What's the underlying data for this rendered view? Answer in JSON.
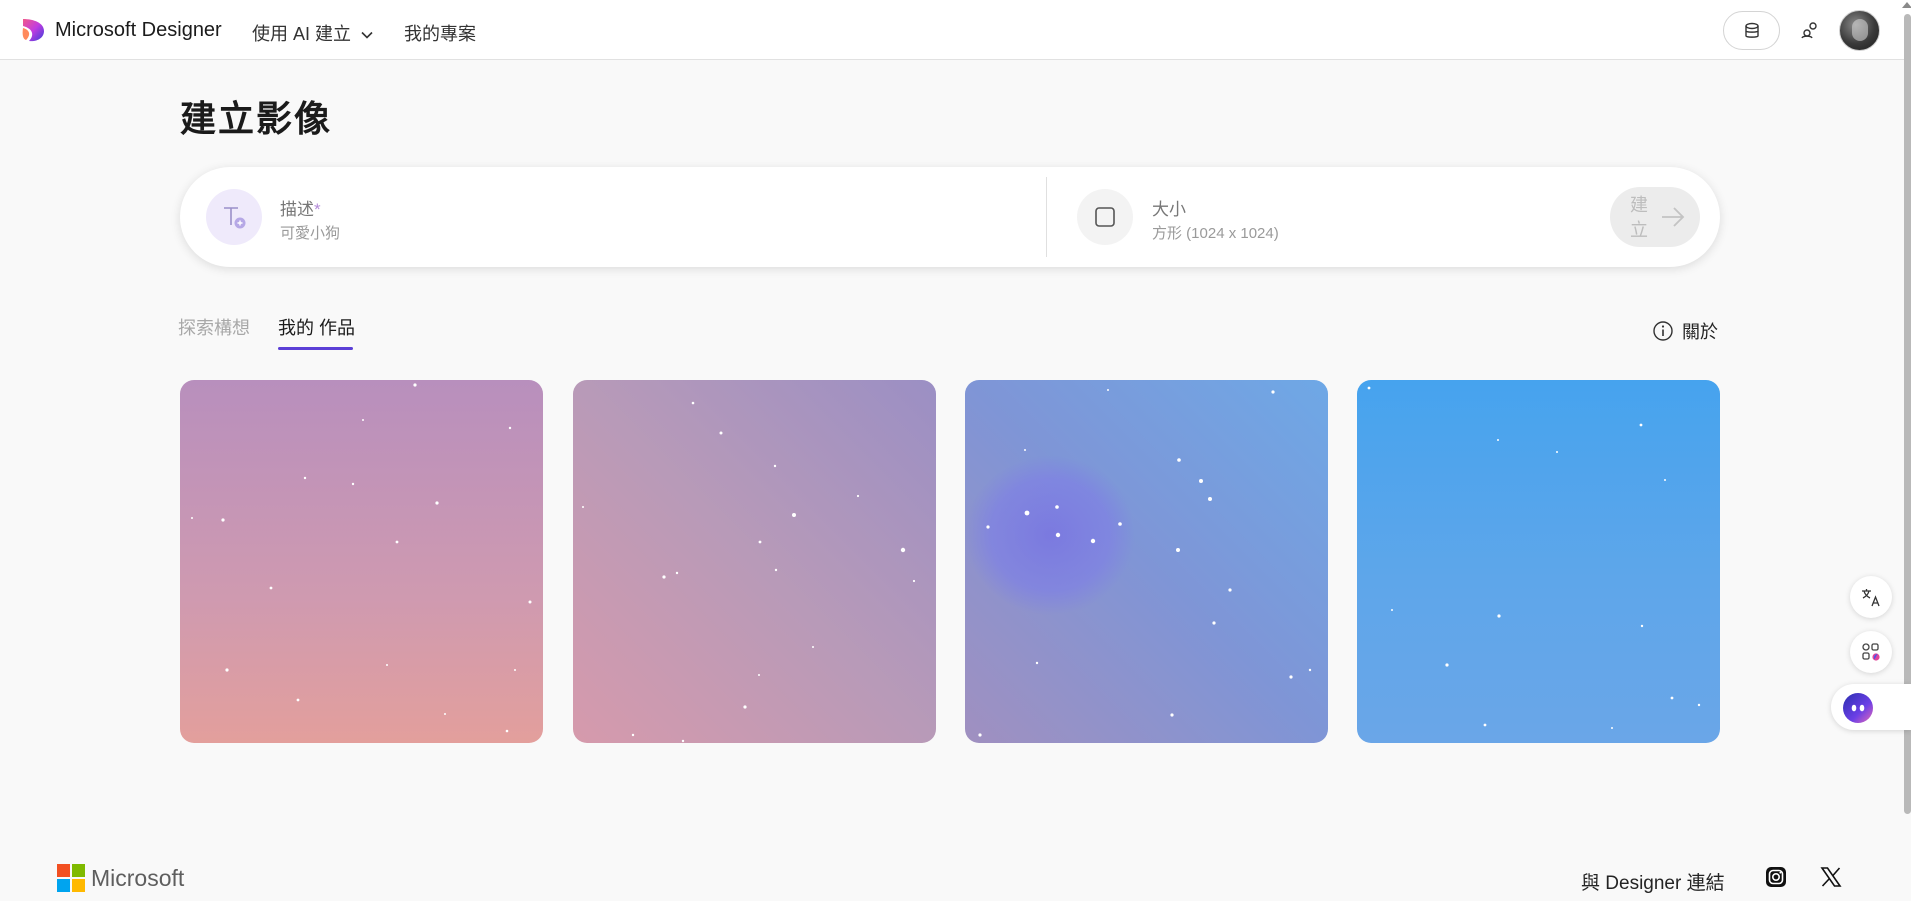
{
  "header": {
    "brand": "Microsoft Designer",
    "nav_ai": "使用 AI 建立",
    "nav_projects": "我的專案"
  },
  "page": {
    "title": "建立影像"
  },
  "prompt": {
    "description_label": "描述",
    "required_mark": "*",
    "description_placeholder": "可愛小狗",
    "size_label": "大小",
    "size_value": "方形 (1024 x 1024)",
    "create_label": "建立"
  },
  "tabs": {
    "explore": "探索構想",
    "mine": "我的 作品",
    "about": "關於"
  },
  "footer": {
    "microsoft": "Microsoft",
    "connect": "與 Designer 連結"
  },
  "colors": {
    "accent": "#5b3fd6",
    "create_button_bg": "#ececec"
  },
  "icons": {
    "logo": "designer-logo-icon",
    "chevron": "chevron-down-icon",
    "credits": "coins-icon",
    "share": "share-icon",
    "description": "text-add-icon",
    "size": "square-icon",
    "create_arrow": "arrow-right-icon",
    "about": "info-icon",
    "translate": "translate-icon",
    "apps": "apps-icon",
    "copilot": "copilot-icon",
    "instagram": "instagram-icon",
    "x": "x-icon"
  }
}
